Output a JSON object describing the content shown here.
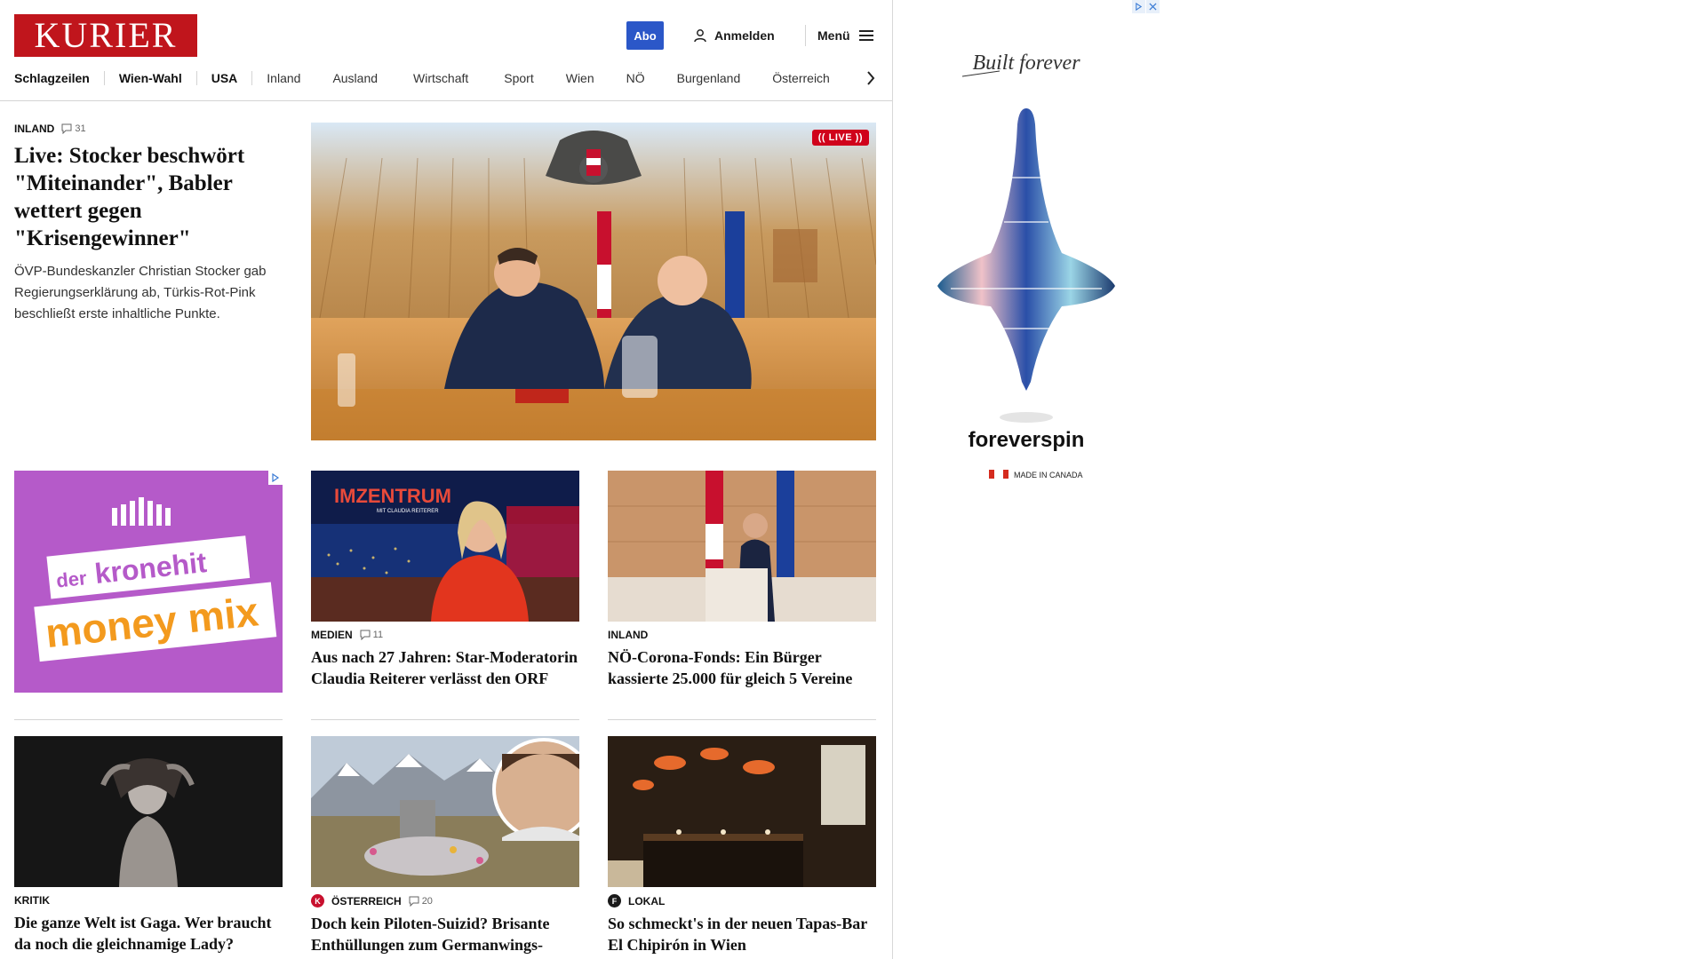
{
  "header": {
    "logo_text": "KURIER",
    "abo_label": "Abo",
    "login_label": "Anmelden",
    "menu_label": "Menü"
  },
  "nav": {
    "items": [
      "Schlagzeilen",
      "Wien-Wahl",
      "USA",
      "Inland",
      "Ausland",
      "Wirtschaft",
      "Sport",
      "Wien",
      "NÖ",
      "Burgenland",
      "Österreich"
    ]
  },
  "lead": {
    "kicker": "INLAND",
    "comments": "31",
    "headline": "Live: Stocker beschwört \"Miteinander\", Babler wettert gegen \"Krisengewinner\"",
    "teaser": "ÖVP-Bundeskanzler Christian Stocker gab Regierungserklärung ab, Türkis-Rot-Pink beschließt erste inhaltliche Punkte.",
    "badge": "LIVE"
  },
  "ad_small": {
    "line1": "der",
    "line2": "kronehit",
    "line3": "money mix"
  },
  "cards": [
    {
      "kicker": "MEDIEN",
      "comments": "11",
      "headline": "Aus nach 27 Jahren: Star-Moderatorin Claudia Reiterer verlässt den ORF",
      "thumb_text": "IMZENTRUM",
      "thumb_subtext": "MIT CLAUDIA REITERER"
    },
    {
      "kicker": "INLAND",
      "headline": "NÖ-Corona-Fonds: Ein Bürger kassierte 25.000 für gleich 5 Vereine"
    },
    {
      "kicker": "KRITIK",
      "headline": "Die ganze Welt ist Gaga. Wer braucht da noch die gleichnamige Lady?"
    },
    {
      "kicker": "ÖSTERREICH",
      "comments": "20",
      "headline": "Doch kein Piloten-Suizid? Brisante Enthüllungen zum Germanwings-Absturz"
    },
    {
      "kicker": "LOKAL",
      "headline": "So schmeckt's in der neuen Tapas-Bar El Chipirón in Wien"
    }
  ],
  "ad_right": {
    "script": "Built forever",
    "brand": "foreverspin",
    "made": "MADE IN CANADA"
  },
  "colors": {
    "brand_red": "#c0151c",
    "abo_blue": "#2b57c8",
    "ad_purple": "#b55ac9",
    "live_red": "#d0021b"
  }
}
